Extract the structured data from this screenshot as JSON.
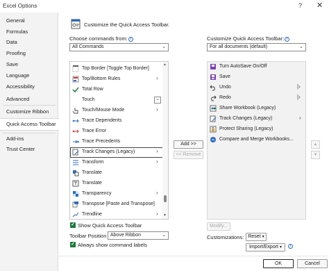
{
  "window": {
    "title": "Excel Options",
    "help": "?",
    "close": "✕"
  },
  "nav": {
    "items": [
      {
        "label": "General"
      },
      {
        "label": "Formulas"
      },
      {
        "label": "Data"
      },
      {
        "label": "Proofing"
      },
      {
        "label": "Save"
      },
      {
        "label": "Language"
      },
      {
        "label": "Accessibility"
      },
      {
        "label": "Advanced"
      },
      {
        "label": "Customize Ribbon"
      },
      {
        "label": "Quick Access Toolbar"
      },
      {
        "label": "Add-ins"
      },
      {
        "label": "Trust Center"
      }
    ],
    "active_index": 9
  },
  "header": {
    "title": "Customize the Quick Access Toolbar."
  },
  "left": {
    "choose_label": "Choose commands from:",
    "choose_value": "All Commands",
    "commands": [
      {
        "label": "Top Border [Toggle Top Border]",
        "icon": "top-border-icon",
        "arrow": ""
      },
      {
        "label": "Top/Bottom Rules",
        "icon": "top-bottom-rules-icon",
        "arrow": "›"
      },
      {
        "label": "Total Row",
        "icon": "checkmark-icon",
        "arrow": ""
      },
      {
        "label": "Touch",
        "icon": "",
        "arrow": "⌄"
      },
      {
        "label": "Touch/Mouse Mode",
        "icon": "hand-pointer-icon",
        "arrow": "›"
      },
      {
        "label": "Trace Dependents",
        "icon": "trace-dependents-icon",
        "arrow": ""
      },
      {
        "label": "Trace Error",
        "icon": "trace-error-icon",
        "arrow": ""
      },
      {
        "label": "Trace Precedents",
        "icon": "trace-precedents-icon",
        "arrow": ""
      },
      {
        "label": "Track Changes (Legacy)",
        "icon": "track-changes-icon",
        "arrow": "›",
        "selected": true
      },
      {
        "label": "Transform",
        "icon": "transform-icon",
        "arrow": "›"
      },
      {
        "label": "Translate",
        "icon": "translate-icon",
        "arrow": ""
      },
      {
        "label": "Translate",
        "icon": "translate-icon",
        "arrow": ""
      },
      {
        "label": "Transparency",
        "icon": "transparency-icon",
        "arrow": "›"
      },
      {
        "label": "Transpose [Paste and Transpose]",
        "icon": "transpose-icon",
        "arrow": ""
      },
      {
        "label": "Trendline",
        "icon": "trendline-icon",
        "arrow": "›"
      }
    ],
    "show_qat_label": "Show Quick Access Toolbar",
    "toolbar_position_label": "Toolbar Position",
    "toolbar_position_value": "Above Ribbon",
    "always_show_labels_label": "Always show command labels"
  },
  "middle": {
    "add_label": "Add >>",
    "remove_label": "<< Remove"
  },
  "right": {
    "customize_label": "Customize Quick Access Toolbar:",
    "customize_value": "For all documents (default)",
    "items": [
      {
        "label": "Turn AutoSave On/Off",
        "icon": "autosave-icon",
        "arrow": ""
      },
      {
        "label": "Save",
        "icon": "save-icon",
        "arrow": ""
      },
      {
        "label": "Undo",
        "icon": "undo-icon",
        "arrow": "|›"
      },
      {
        "label": "Redo",
        "icon": "redo-icon",
        "arrow": "|›"
      },
      {
        "label": "Share Workbook (Legacy)",
        "icon": "share-workbook-icon",
        "arrow": ""
      },
      {
        "label": "Track Changes (Legacy)",
        "icon": "track-changes-icon",
        "arrow": "›"
      },
      {
        "label": "Protect Sharing (Legacy)",
        "icon": "protect-sharing-icon",
        "arrow": ""
      },
      {
        "label": "Compare and Merge Workbooks...",
        "icon": "compare-merge-icon",
        "arrow": ""
      }
    ],
    "modify_label": "Modify...",
    "customizations_label": "Customizations:",
    "reset_label": "Reset",
    "import_export_label": "Import/Export"
  },
  "footer": {
    "ok_label": "OK",
    "cancel_label": "Cancel"
  },
  "colors": {
    "accent": "#1a7a3a",
    "nav_bg": "#f3f3f3",
    "list_bg": "#f2f2f2"
  }
}
